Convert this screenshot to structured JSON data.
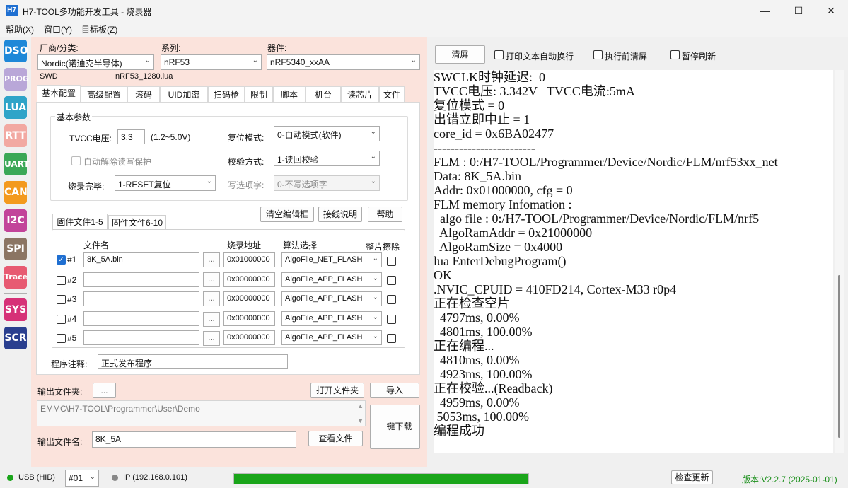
{
  "window": {
    "title": "H7-TOOL多功能开发工具 - 烧录器",
    "app_icon": "H7",
    "minimize": "—",
    "maximize": "☐",
    "close": "✕"
  },
  "menu": [
    "帮助(X)",
    "窗口(Y)",
    "目标板(Z)"
  ],
  "side_icons": [
    {
      "label": "DSO",
      "color": "#1e88d8"
    },
    {
      "label": "PROG",
      "color": "#b9a7d8"
    },
    {
      "label": "LUA",
      "color": "#2fa4c8"
    },
    {
      "label": "RTT",
      "color": "#f2a9a2"
    },
    {
      "label": "UART",
      "color": "#3aa857"
    },
    {
      "label": "CAN",
      "color": "#f39a1e"
    },
    {
      "label": "I2C",
      "color": "#c2449a"
    },
    {
      "label": "SPI",
      "color": "#8b7563"
    },
    {
      "label": "Trace",
      "color": "#e75a72"
    },
    {
      "label": "SYS",
      "color": "#d63177"
    },
    {
      "label": "SCR",
      "color": "#2a3f8f"
    }
  ],
  "device": {
    "vendor_label": "厂商/分类:",
    "vendor_value": "Nordic(诺迪克半导体)",
    "series_label": "系列:",
    "series_value": "nRF53",
    "device_label": "器件:",
    "device_value": "nRF5340_xxAA",
    "interface": "SWD",
    "lua_file": "nRF53_1280.lua"
  },
  "tabs": [
    "基本配置",
    "高级配置",
    "滚码",
    "UID加密",
    "扫码枪",
    "限制",
    "脚本",
    "机台",
    "读芯片",
    "文件"
  ],
  "basic": {
    "group_title": "基本参数",
    "tvcc_label": "TVCC电压:",
    "tvcc_value": "3.3",
    "tvcc_range": "(1.2~5.0V)",
    "reset_label": "复位模式:",
    "reset_value": "0-自动模式(软件)",
    "unlock_label": "自动解除读写保护",
    "verify_label": "校验方式:",
    "verify_value": "1-读回校验",
    "finish_label": "烧录完毕:",
    "finish_value": "1-RESET复位",
    "optbyte_label": "写选项字:",
    "optbyte_value": "0-不写选项字"
  },
  "buttons": {
    "clear_edit": "清空编辑框",
    "wiring": "接线说明",
    "help": "帮助"
  },
  "fw_tabs": [
    "固件文件1-5",
    "固件文件6-10"
  ],
  "fw_headers": {
    "file": "文件名",
    "addr": "烧录地址",
    "algo": "算法选择",
    "erase": "整片擦除"
  },
  "fw_rows": [
    {
      "id": "#1",
      "checked": true,
      "file": "8K_5A.bin",
      "browse": "...",
      "addr": "0x01000000",
      "algo": "AlgoFile_NET_FLASH"
    },
    {
      "id": "#2",
      "checked": false,
      "file": "",
      "browse": "...",
      "addr": "0x00000000",
      "algo": "AlgoFile_APP_FLASH"
    },
    {
      "id": "#3",
      "checked": false,
      "file": "",
      "browse": "...",
      "addr": "0x00000000",
      "algo": "AlgoFile_APP_FLASH"
    },
    {
      "id": "#4",
      "checked": false,
      "file": "",
      "browse": "...",
      "addr": "0x00000000",
      "algo": "AlgoFile_APP_FLASH"
    },
    {
      "id": "#5",
      "checked": false,
      "file": "",
      "browse": "...",
      "addr": "0x00000000",
      "algo": "AlgoFile_APP_FLASH"
    }
  ],
  "note": {
    "label": "程序注释:",
    "value": "正式发布程序"
  },
  "output": {
    "folder_label": "输出文件夹:",
    "folder_btn": "...",
    "open_folder": "打开文件夹",
    "import": "导入",
    "path": "EMMC\\H7-TOOL\\Programmer\\User\\Demo",
    "name_label": "输出文件名:",
    "name_value": "8K_5A",
    "view_file": "查看文件",
    "one_key": "一键下载"
  },
  "log_toolbar": {
    "clear": "清屏",
    "wrap": "打印文本自动换行",
    "clear_before": "执行前清屏",
    "pause": "暂停刷新"
  },
  "log": [
    "SWCLK时钟延迟:  0",
    "TVCC电压: 3.342V   TVCC电流:5mA",
    "复位模式 = 0",
    "出错立即中止 = 1",
    "core_id = 0x6BA02477",
    "------------------------",
    "FLM : 0:/H7-TOOL/Programmer/Device/Nordic/FLM/nrf53xx_net",
    "Data: 8K_5A.bin",
    "Addr: 0x01000000, cfg = 0",
    "FLM memory Infomation :",
    "  algo file : 0:/H7-TOOL/Programmer/Device/Nordic/FLM/nrf5",
    "  AlgoRamAddr = 0x21000000",
    "  AlgoRamSize = 0x4000",
    "lua EnterDebugProgram()",
    "OK",
    ".NVIC_CPUID = 410FD214, Cortex-M33 r0p4",
    "正在检查空片",
    "  4797ms, 0.00%",
    "  4801ms, 100.00%",
    "正在编程...",
    "  4810ms, 0.00%",
    "  4923ms, 100.00%",
    "正在校验...(Readback)",
    "  4959ms, 0.00%",
    " 5053ms, 100.00%",
    "编程成功"
  ],
  "status": {
    "usb": "USB (HID)",
    "port": "#01",
    "ip": "IP (192.168.0.101)",
    "progress": 1.0,
    "check_update": "检查更新",
    "version": "版本:V2.2.7 (2025-01-01)",
    "accent_green": "#1aa51a"
  }
}
